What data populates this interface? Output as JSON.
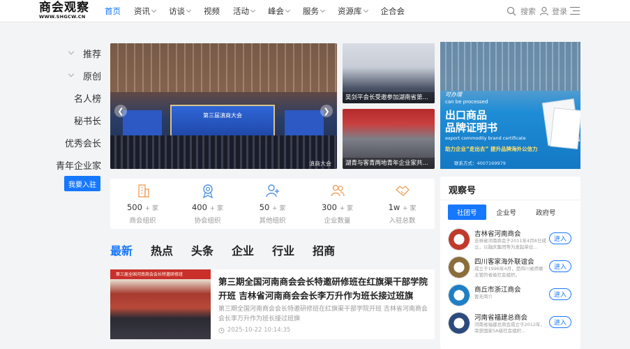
{
  "header": {
    "logo_cn": "商会观察",
    "logo_en": "WWW.SHGCW.CN",
    "nav": [
      {
        "label": "首页",
        "active": true,
        "dropdown": false
      },
      {
        "label": "资讯",
        "active": false,
        "dropdown": true
      },
      {
        "label": "访谈",
        "active": false,
        "dropdown": true
      },
      {
        "label": "视频",
        "active": false,
        "dropdown": false
      },
      {
        "label": "活动",
        "active": false,
        "dropdown": true
      },
      {
        "label": "峰会",
        "active": false,
        "dropdown": true
      },
      {
        "label": "服务",
        "active": false,
        "dropdown": true
      },
      {
        "label": "资源库",
        "active": false,
        "dropdown": true
      },
      {
        "label": "企合会",
        "active": false,
        "dropdown": false
      }
    ],
    "search_label": "搜索",
    "login_label": "登录",
    "accent": "#1677ff"
  },
  "sidebar": {
    "items": [
      {
        "label": "推荐",
        "chevron": true
      },
      {
        "label": "原创",
        "chevron": true
      },
      {
        "label": "名人榜",
        "chevron": false
      },
      {
        "label": "秘书长",
        "chevron": false
      },
      {
        "label": "优秀会长",
        "chevron": false
      },
      {
        "label": "青年企业家",
        "chevron": false
      }
    ],
    "join_button": "我要入驻"
  },
  "banner": {
    "stage_title": "第三届滇商大会",
    "caption": "滇商大会"
  },
  "thumbs": [
    {
      "caption": "吴剑平会长受邀参加湖南省第..."
    },
    {
      "caption": "湖青与客青两地青年企业家共..."
    }
  ],
  "ad": {
    "line1": "可办理",
    "line2": "can be processed",
    "title1": "出口商品",
    "title2": "品牌证明书",
    "line3": "export commodity brand certificate",
    "slogan": "助力企业“走出去” 提升品牌海外公信力",
    "phone": "联系方式：4007169979"
  },
  "stats": [
    {
      "value": "500",
      "unit": "+ 家",
      "label": "商会组织",
      "icon": "building-icon"
    },
    {
      "value": "400",
      "unit": "+ 家",
      "label": "协会组织",
      "icon": "medal-icon"
    },
    {
      "value": "50",
      "unit": "+ 家",
      "label": "其他组织",
      "icon": "user-add-icon"
    },
    {
      "value": "300",
      "unit": "+ 家",
      "label": "企业数量",
      "icon": "users-icon"
    },
    {
      "value": "1w",
      "unit": "+ 家",
      "label": "入驻总数",
      "icon": "handshake-icon"
    }
  ],
  "tabs": [
    {
      "label": "最新",
      "active": true
    },
    {
      "label": "热点",
      "active": false
    },
    {
      "label": "头条",
      "active": false
    },
    {
      "label": "企业",
      "active": false
    },
    {
      "label": "行业",
      "active": false
    },
    {
      "label": "招商",
      "active": false
    }
  ],
  "news": {
    "image_banner": "第三届全国河南商会会长特邀研修班",
    "title": "第三期全国河南商会会长特邀研修班在红旗渠干部学院开班 吉林省河南商会会长李万升作为班长接过班旗",
    "desc": "第三期全国河南商会会长特邀研修班在红旗渠干部学院开班 吉林省河南商会会长李万升作为班长接过班旗",
    "time": "2025-10-22 10:14:35"
  },
  "observe": {
    "title": "观察号",
    "tabs": [
      {
        "label": "社团号",
        "active": true
      },
      {
        "label": "企业号",
        "active": false
      },
      {
        "label": "政府号",
        "active": false
      }
    ],
    "enter_label": "进入",
    "orgs": [
      {
        "name": "吉林省河南商会",
        "desc": "吉林省河南商会于2011年4月8日成立，以融庆集团等为发起单位...",
        "color": "#c0392b"
      },
      {
        "name": "四川客家海外联谊会",
        "desc": "成立于1996年4月，是四川省侨联主管的省级社会组织。",
        "color": "#8a6d3b"
      },
      {
        "name": "商丘市浙江商会",
        "desc": "暂无简介",
        "color": "#1f7fc4"
      },
      {
        "name": "河南省福建总商会",
        "desc": "河南省福建总商会成立于2012年，荣获国家5A级社会组织...",
        "color": "#2c4a7c"
      }
    ]
  }
}
